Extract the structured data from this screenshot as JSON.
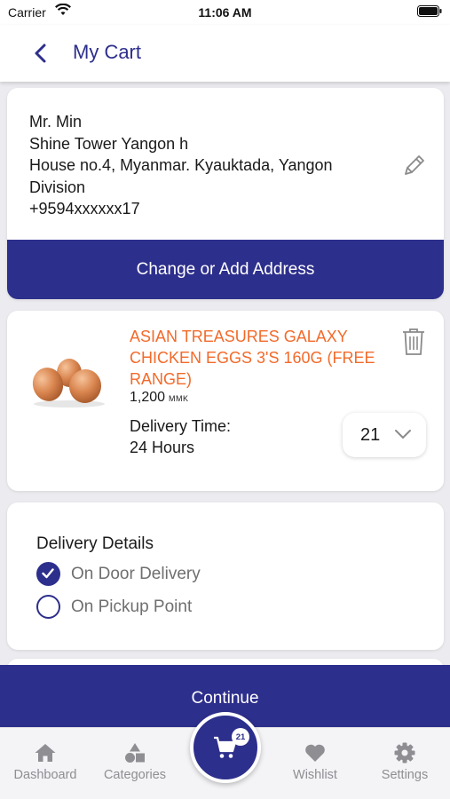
{
  "status_bar": {
    "carrier": "Carrier",
    "time": "11:06 AM"
  },
  "nav": {
    "title": "My Cart"
  },
  "address": {
    "lines": [
      "Mr. Min",
      "Shine Tower Yangon h",
      "House no.4,  Myanmar. Kyauktada, Yangon",
      "Division",
      "+9594xxxxxx17"
    ],
    "button_label": "Change or Add Address"
  },
  "product": {
    "name": "ASIAN TREASURES GALAXY CHICKEN EGGS 3'S 160G (FREE RANGE)",
    "price": "1,200",
    "currency": "MMK",
    "delivery_time_label": "Delivery Time:",
    "delivery_time_value": "24 Hours",
    "quantity": "21",
    "name_color": "#f26a2a"
  },
  "delivery": {
    "title": "Delivery Details",
    "options": [
      {
        "label": "On Door Delivery",
        "selected": true
      },
      {
        "label": "On Pickup Point",
        "selected": false
      }
    ]
  },
  "continue_label": "Continue",
  "tabs": [
    {
      "label": "Dashboard",
      "icon": "home-icon"
    },
    {
      "label": "Categories",
      "icon": "categories-icon"
    },
    {
      "label": "Cart",
      "icon": "cart-icon"
    },
    {
      "label": "Wishlist",
      "icon": "heart-icon"
    },
    {
      "label": "Settings",
      "icon": "gear-icon"
    }
  ],
  "cart_badge": "21",
  "colors": {
    "primary": "#2d2f8c",
    "accent": "#f26a2a",
    "tab_inactive": "#8e8e93"
  }
}
